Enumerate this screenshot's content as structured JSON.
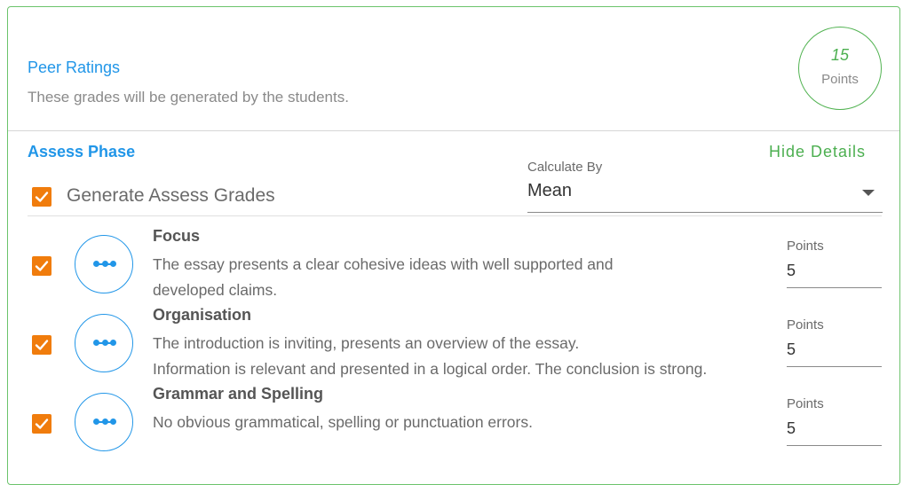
{
  "peer_ratings": {
    "title": "Peer Ratings",
    "subtitle": "These grades will be generated by the students.",
    "points_value": "15",
    "points_label": "Points"
  },
  "assess_phase": {
    "title": "Assess Phase",
    "hide_details": "Hide Details",
    "generate_label": "Generate Assess Grades",
    "generate_checked": true,
    "calculate_by_label": "Calculate By",
    "calculate_by_value": "Mean"
  },
  "criteria": [
    {
      "title": "Focus",
      "description_lines": [
        "The essay presents a clear cohesive ideas with well supported and",
        "developed claims."
      ],
      "points_label": "Points",
      "points_value": "5",
      "checked": true
    },
    {
      "title": "Organisation",
      "description_lines": [
        "The introduction is inviting, presents an overview of the essay.",
        "Information is relevant and presented in a logical order. The conclusion is strong."
      ],
      "points_label": "Points",
      "points_value": "5",
      "checked": true
    },
    {
      "title": "Grammar and Spelling",
      "description_lines": [
        "No obvious grammatical, spelling or punctuation errors."
      ],
      "points_label": "Points",
      "points_value": "5",
      "checked": true
    }
  ],
  "colors": {
    "accent_blue": "#2196e8",
    "accent_green": "#4caf50",
    "checkbox_orange": "#f07c0c"
  },
  "icons": {
    "checkbox": "check-icon",
    "criterion": "more-dots-icon",
    "dropdown": "caret-down-icon"
  }
}
